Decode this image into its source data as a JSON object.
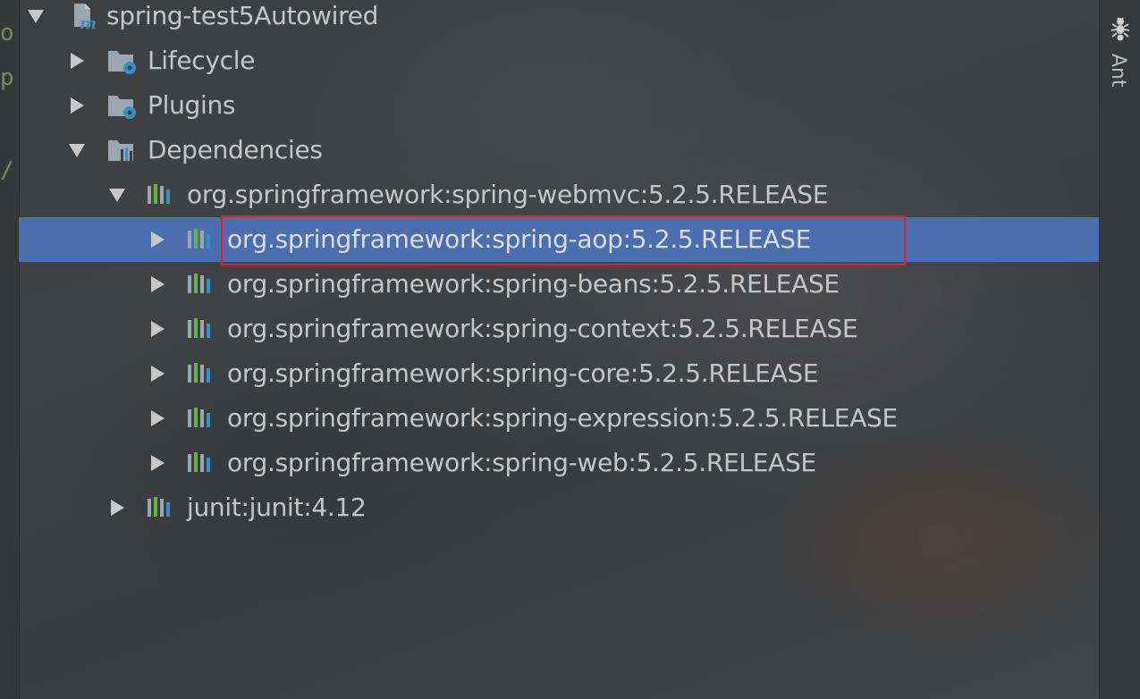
{
  "gutter": {
    "chars": [
      "o",
      "p",
      "/"
    ]
  },
  "tool_window": {
    "ant_label": "Ant",
    "ant_icon": "ant-icon"
  },
  "tree": {
    "root": {
      "label": "spring-test5Autowired",
      "icon": "maven-project-icon",
      "expanded": true
    },
    "lifecycle": {
      "label": "Lifecycle",
      "icon": "folder-gear-icon",
      "expanded": false
    },
    "plugins": {
      "label": "Plugins",
      "icon": "folder-gear-icon",
      "expanded": false
    },
    "dependencies": {
      "label": "Dependencies",
      "icon": "folder-library-icon",
      "expanded": true
    },
    "webmvc": {
      "label": "org.springframework:spring-webmvc:5.2.5.RELEASE",
      "icon": "library-icon",
      "expanded": true
    },
    "children": [
      {
        "label": "org.springframework:spring-aop:5.2.5.RELEASE",
        "selected": true
      },
      {
        "label": "org.springframework:spring-beans:5.2.5.RELEASE"
      },
      {
        "label": "org.springframework:spring-context:5.2.5.RELEASE"
      },
      {
        "label": "org.springframework:spring-core:5.2.5.RELEASE"
      },
      {
        "label": "org.springframework:spring-expression:5.2.5.RELEASE"
      },
      {
        "label": "org.springframework:spring-web:5.2.5.RELEASE"
      }
    ],
    "junit": {
      "label": "junit:junit:4.12",
      "icon": "library-icon",
      "expanded": false
    }
  },
  "colors": {
    "selection": "#4b6eaf",
    "highlight_box": "#e0222a",
    "text": "#c6c6c6"
  }
}
